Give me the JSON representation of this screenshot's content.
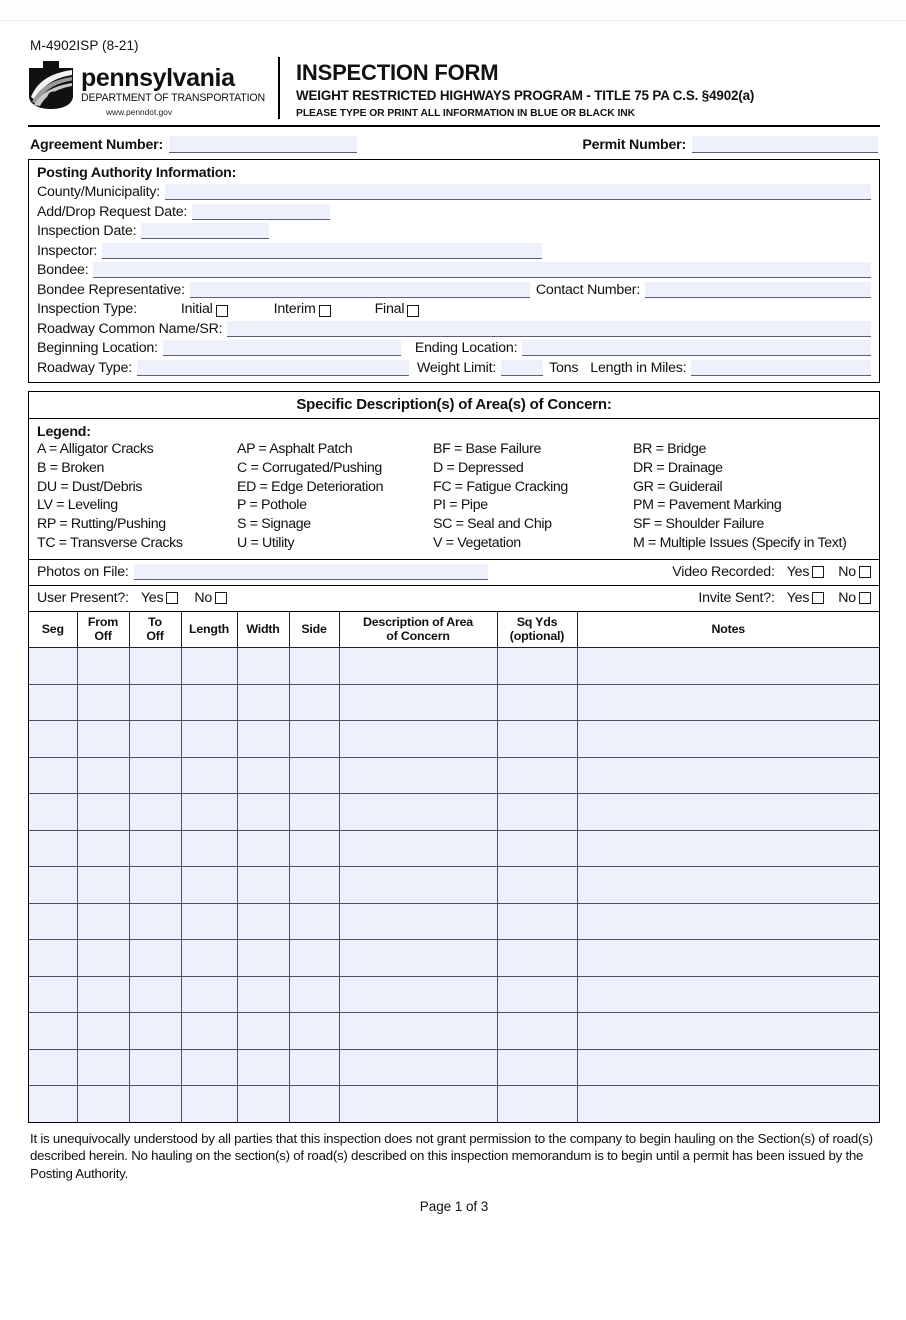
{
  "header": {
    "form_code": "M-4902ISP (8-21)",
    "agency_name": "pennsylvania",
    "agency_dept": "DEPARTMENT OF TRANSPORTATION",
    "agency_url": "www.penndot.gov",
    "title": "INSPECTION FORM",
    "subtitle": "WEIGHT RESTRICTED HIGHWAYS PROGRAM - TITLE 75 PA C.S. §4902(a)",
    "instruction": "PLEASE TYPE OR PRINT ALL INFORMATION IN BLUE OR BLACK INK"
  },
  "top_fields": {
    "agreement_number_label": "Agreement Number:",
    "agreement_number_value": "",
    "permit_number_label": "Permit Number:",
    "permit_number_value": ""
  },
  "posting_authority": {
    "heading": "Posting Authority Information:",
    "county_label": "County/Municipality:",
    "county_value": "",
    "add_drop_label": "Add/Drop Request Date:",
    "add_drop_value": "",
    "inspection_date_label": "Inspection Date:",
    "inspection_date_value": "",
    "inspector_label": "Inspector:",
    "inspector_value": "",
    "bondee_label": "Bondee:",
    "bondee_value": "",
    "bondee_rep_label": "Bondee Representative:",
    "bondee_rep_value": "",
    "contact_number_label": "Contact Number:",
    "contact_number_value": "",
    "inspection_type_label": "Inspection Type:",
    "type_initial": "Initial",
    "type_interim": "Interim",
    "type_final": "Final",
    "roadway_name_label": "Roadway Common Name/SR:",
    "roadway_name_value": "",
    "beginning_location_label": "Beginning Location:",
    "beginning_location_value": "",
    "ending_location_label": "Ending Location:",
    "ending_location_value": "",
    "roadway_type_label": "Roadway Type:",
    "roadway_type_value": "",
    "weight_limit_label": "Weight Limit:",
    "weight_limit_value": "",
    "tons_label": "Tons",
    "length_miles_label": "Length in Miles:",
    "length_miles_value": ""
  },
  "concern": {
    "section_title": "Specific Description(s) of Area(s) of Concern:",
    "legend_heading": "Legend:",
    "legend": [
      "A = Alligator Cracks",
      "AP = Asphalt Patch",
      "BF = Base Failure",
      "BR = Bridge",
      "B = Broken",
      "C = Corrugated/Pushing",
      "D = Depressed",
      "DR = Drainage",
      "DU = Dust/Debris",
      "ED = Edge Deterioration",
      "FC = Fatigue Cracking",
      "GR = Guiderail",
      "LV = Leveling",
      "P = Pothole",
      "PI = Pipe",
      "PM = Pavement Marking",
      "RP = Rutting/Pushing",
      "S = Signage",
      "SC = Seal and Chip",
      "SF = Shoulder Failure",
      "TC = Transverse Cracks",
      "U = Utility",
      "V = Vegetation",
      "M = Multiple Issues (Specify in Text)"
    ],
    "photos_label": "Photos on File:",
    "photos_value": "",
    "video_label": "Video Recorded:",
    "user_present_label": "User Present?:",
    "invite_sent_label": "Invite Sent?:",
    "yes_label": "Yes",
    "no_label": "No"
  },
  "table": {
    "columns": [
      "Seg",
      "From\nOff",
      "To\nOff",
      "Length",
      "Width",
      "Side",
      "Description of Area\nof Concern",
      "Sq Yds\n(optional)",
      "Notes"
    ],
    "row_count": 13,
    "rows": []
  },
  "footer": {
    "disclaimer": "It is unequivocally understood by all parties that this inspection does not grant permission to the company to begin hauling on the Section(s) of road(s) described herein. No hauling on the section(s) of road(s) described on this inspection memorandum is to begin until a permit has been issued by the Posting Authority.",
    "page_number": "Page 1 of 3"
  },
  "colors": {
    "field_fill": "#eef0fb",
    "field_rule": "#5a5f73",
    "border": "#000000"
  }
}
